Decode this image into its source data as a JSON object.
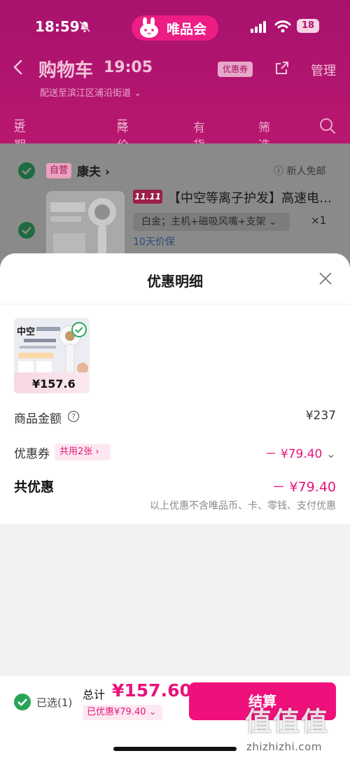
{
  "status_bar": {
    "time": "18:59",
    "battery": "18"
  },
  "app_pill": {
    "label": "唯品会"
  },
  "header": {
    "title": "购物车",
    "time": "19:05",
    "coupon_tag": "优惠券",
    "manage": "管理",
    "address": "配送至滨江区浦沿街道"
  },
  "filters": [
    "近期加购",
    "降价",
    "有货",
    "筛选"
  ],
  "cart": {
    "self_op_tag": "自营",
    "shop_name": "康夫",
    "free_ship": "新人免邮",
    "promo_tag": "11.11",
    "product_title": "【中空等离子护发】高速电…",
    "spec": "白金；主机+磁吸风嘴+支架",
    "qty": "×1",
    "price_protect": "10天价保"
  },
  "sheet": {
    "title": "优惠明细",
    "card_price": "¥157.6",
    "goods_amount_label": "商品金额",
    "goods_amount_value": "¥237",
    "coupon_label": "优惠券",
    "coupon_chip": "共用2张",
    "coupon_value": "－ ¥79.40",
    "total_label": "共优惠",
    "total_value": "－ ¥79.40",
    "note": "以上优惠不含唯品币、卡、零钱、支付优惠"
  },
  "bottom_bar": {
    "selected": "已选(1)",
    "sum_label": "总计",
    "sum_value": "¥157.60",
    "saved": "已优惠¥79.40",
    "checkout": "结算"
  },
  "watermark": {
    "text": "值值值",
    "url": "zhizhizhi.com"
  },
  "colors": {
    "accent": "#e8137b",
    "check_green": "#28a457"
  }
}
